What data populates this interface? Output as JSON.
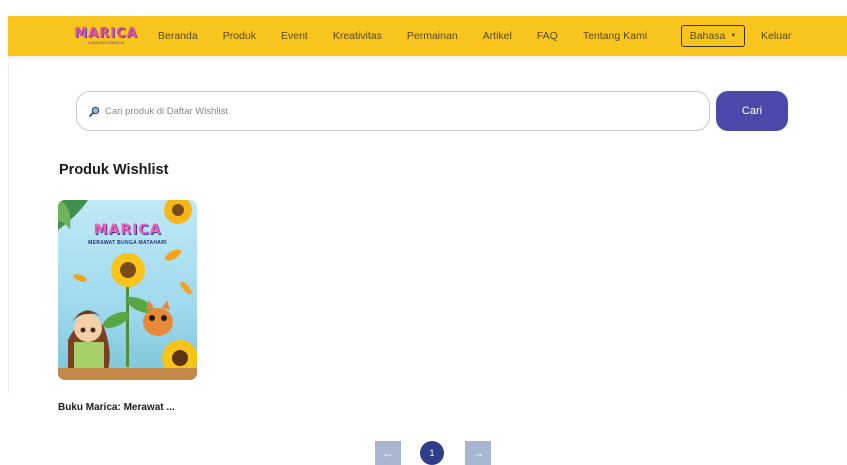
{
  "header": {
    "logo_text": "MARICA",
    "logo_tagline": "LINDUNGI MARICA",
    "nav": [
      "Beranda",
      "Produk",
      "Event",
      "Kreativitas",
      "Permainan",
      "Artikel",
      "FAQ",
      "Tentang Kami"
    ],
    "language_label": "Bahasa",
    "logout_label": "Keluar"
  },
  "search": {
    "placeholder": "Cari produk di Daftar Wishlist",
    "value": "",
    "button_label": "Cari"
  },
  "wishlist": {
    "title": "Produk Wishlist",
    "products": [
      {
        "name": "Buku Marica: Merawat ...",
        "cover_brand": "MARICA",
        "cover_title": "MERAWAT BUNGA MATAHARI"
      }
    ]
  },
  "pagination": {
    "prev_icon": "arrow-left-icon",
    "next_icon": "arrow-right-icon",
    "current_page": "1"
  },
  "colors": {
    "navbar": "#f7c51e",
    "primary_button": "#4a48a8",
    "active_page": "#2f3c8a",
    "inactive_pager": "#a9b6d0"
  }
}
